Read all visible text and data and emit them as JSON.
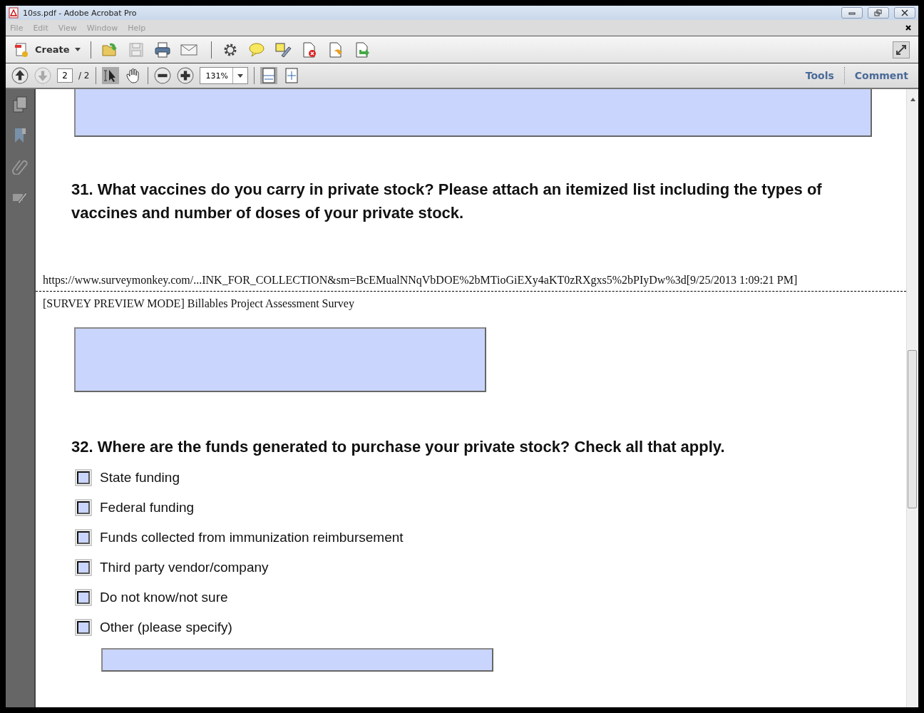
{
  "window": {
    "title": "10ss.pdf - Adobe Acrobat Pro"
  },
  "menu": [
    "File",
    "Edit",
    "View",
    "Window",
    "Help"
  ],
  "toolbar": {
    "create_label": "Create"
  },
  "navigation": {
    "page_value": "2",
    "page_total": "/ 2",
    "zoom": "131%"
  },
  "panel_links": [
    "Tools",
    "Comment"
  ],
  "document": {
    "question_31": "31. What vaccines do you carry in private stock? Please attach an itemized list including the types of vaccines and number of doses of your private stock.",
    "footer_url": "https://www.surveymonkey.com/...INK_FOR_COLLECTION&sm=BcEMualNNqVbDOE%2bMTioGiEXy4aKT0zRXgxs5%2bPIyDw%3d[9/25/2013 1:09:21 PM]",
    "header": "[SURVEY PREVIEW MODE] Billables Project Assessment Survey",
    "question_32": "32. Where are the funds generated to purchase your private stock? Check all that apply.",
    "options": [
      {
        "label": "State funding",
        "checked": false
      },
      {
        "label": "Federal funding",
        "checked": false
      },
      {
        "label": "Funds collected from immunization reimbursement",
        "checked": false
      },
      {
        "label": "Third party vendor/company",
        "checked": false
      },
      {
        "label": "Do not know/not sure",
        "checked": false
      },
      {
        "label": "Other (please specify)",
        "checked": false
      }
    ]
  }
}
